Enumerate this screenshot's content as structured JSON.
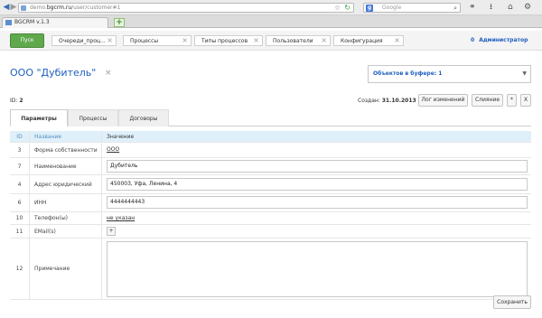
{
  "browser": {
    "url_prefix": "demo.",
    "url_host": "bgcrm.ru",
    "url_path": "/user/customer#1",
    "search_placeholder": "Google",
    "tab_title": "BGCRM v.1.3",
    "new_tab_label": "+"
  },
  "topnav": {
    "start_label": "Пуск",
    "items": [
      {
        "label": "Очереди_проц..."
      },
      {
        "label": "Процессы"
      },
      {
        "label": "Типы процессов"
      },
      {
        "label": "Пользователи"
      },
      {
        "label": "Конфигурация"
      }
    ],
    "close_glyph": "×",
    "admin_icon": "0",
    "admin_label": "Администратор"
  },
  "page": {
    "title": "ООО \"Дубитель\"",
    "title_close": "×",
    "buffer_label": "Объектов в буфере: 1",
    "buffer_arrow": "▼"
  },
  "info": {
    "id_label": "ID:",
    "id_value": "2",
    "created_label": "Создан:",
    "created_value": "31.10.2013",
    "log_button": "Лог изменений",
    "merge_button": "Слияние",
    "star_button": "*",
    "close_button": "X"
  },
  "tabs": [
    {
      "label": "Параметры",
      "active": true
    },
    {
      "label": "Процессы",
      "active": false
    },
    {
      "label": "Договоры",
      "active": false
    }
  ],
  "table": {
    "headers": {
      "id": "ID",
      "name": "Название",
      "value": "Значение"
    },
    "rows": [
      {
        "id": "3",
        "name": "Форма собственности",
        "value": "ООО",
        "kind": "link"
      },
      {
        "id": "7",
        "name": "Наименование",
        "value": "Дубитель",
        "kind": "input"
      },
      {
        "id": "4",
        "name": "Адрес юридический",
        "value": "450003, Уфа, Ленина, 4",
        "kind": "input"
      },
      {
        "id": "6",
        "name": "ИНН",
        "value": "4444444443",
        "kind": "input"
      },
      {
        "id": "10",
        "name": "Телефон(ы)",
        "value": "не указан",
        "kind": "link"
      },
      {
        "id": "11",
        "name": "EMail(s)",
        "value": "+",
        "kind": "button"
      },
      {
        "id": "12",
        "name": "Примечание",
        "value": "",
        "kind": "textarea"
      }
    ]
  },
  "save_label": "Сохранить",
  "icons": {
    "back": "◀",
    "forward": "▶",
    "star": "☆",
    "reload": "↻",
    "search": "⌕",
    "binoculars": "⚭",
    "download": "⭳",
    "home": "⌂",
    "gear": "⚙"
  }
}
